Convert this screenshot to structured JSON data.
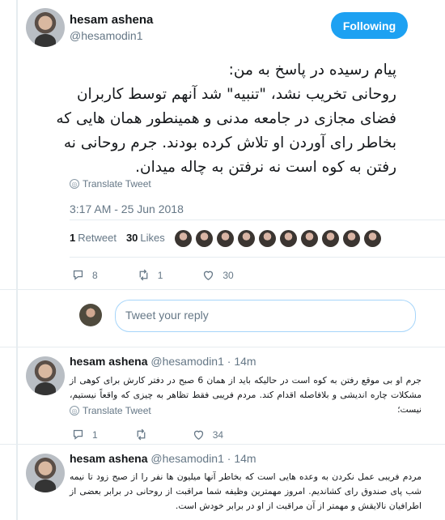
{
  "main": {
    "author_name": "hesam ashena",
    "author_handle": "@hesamodin1",
    "follow_label": "Following",
    "text": "پیام رسیده در پاسخ به من:\nروحانی تخریب نشد، \"تنبیه\" شد آنهم توسط کاربران فضای مجازی در جامعه مدنی و همینطور همان هایی که بخاطر رای آوردن او تلاش کرده بودند. جرم روحانی نه رفتن به کوه است نه نرفتن به چاله میدان.",
    "translate_label": "Translate Tweet",
    "timestamp": "3:17 AM - 25 Jun 2018",
    "retweets_count": "1",
    "retweets_label": "Retweet",
    "likes_count": "30",
    "likes_label": "Likes",
    "actions": {
      "replies": "8",
      "retweets": "1",
      "likes": "30"
    }
  },
  "reply_box": {
    "placeholder": "Tweet your reply"
  },
  "replies": [
    {
      "name": "hesam ashena",
      "handle": "@hesamodin1",
      "time": "14m",
      "text": "جرم او بی موقع رفتن به کوه است در حالیکه باید از همان 6 صبح در دفتر کارش برای کوهی از مشکلات چاره اندیشی و بلافاصله اقدام کند. مردم فریبی فقط تظاهر به چیزی که واقعاً نیستیم، نیست؛",
      "translate_label": "Translate Tweet",
      "actions": {
        "replies": "1",
        "retweets": "",
        "likes": "34"
      }
    },
    {
      "name": "hesam ashena",
      "handle": "@hesamodin1",
      "time": "14m",
      "text": "مردم فریبی عمل نکردن به وعده هایی است که بخاطر آنها میلیون ها نفر را از صبح زود تا نیمه شب پای صندوق رای کشاندیم. امروز مهمترین وظیفه شما مراقبت از روحانی در برابر بعضی از اطرافیان نالایقش و مهمتر از آن مراقبت از او در برابر خودش است."
    }
  ],
  "colors": {
    "accent": "#1da1f2",
    "muted": "#657786",
    "text": "#14171a"
  },
  "icons": [
    "reply-icon",
    "retweet-icon",
    "like-icon",
    "translate-icon"
  ]
}
